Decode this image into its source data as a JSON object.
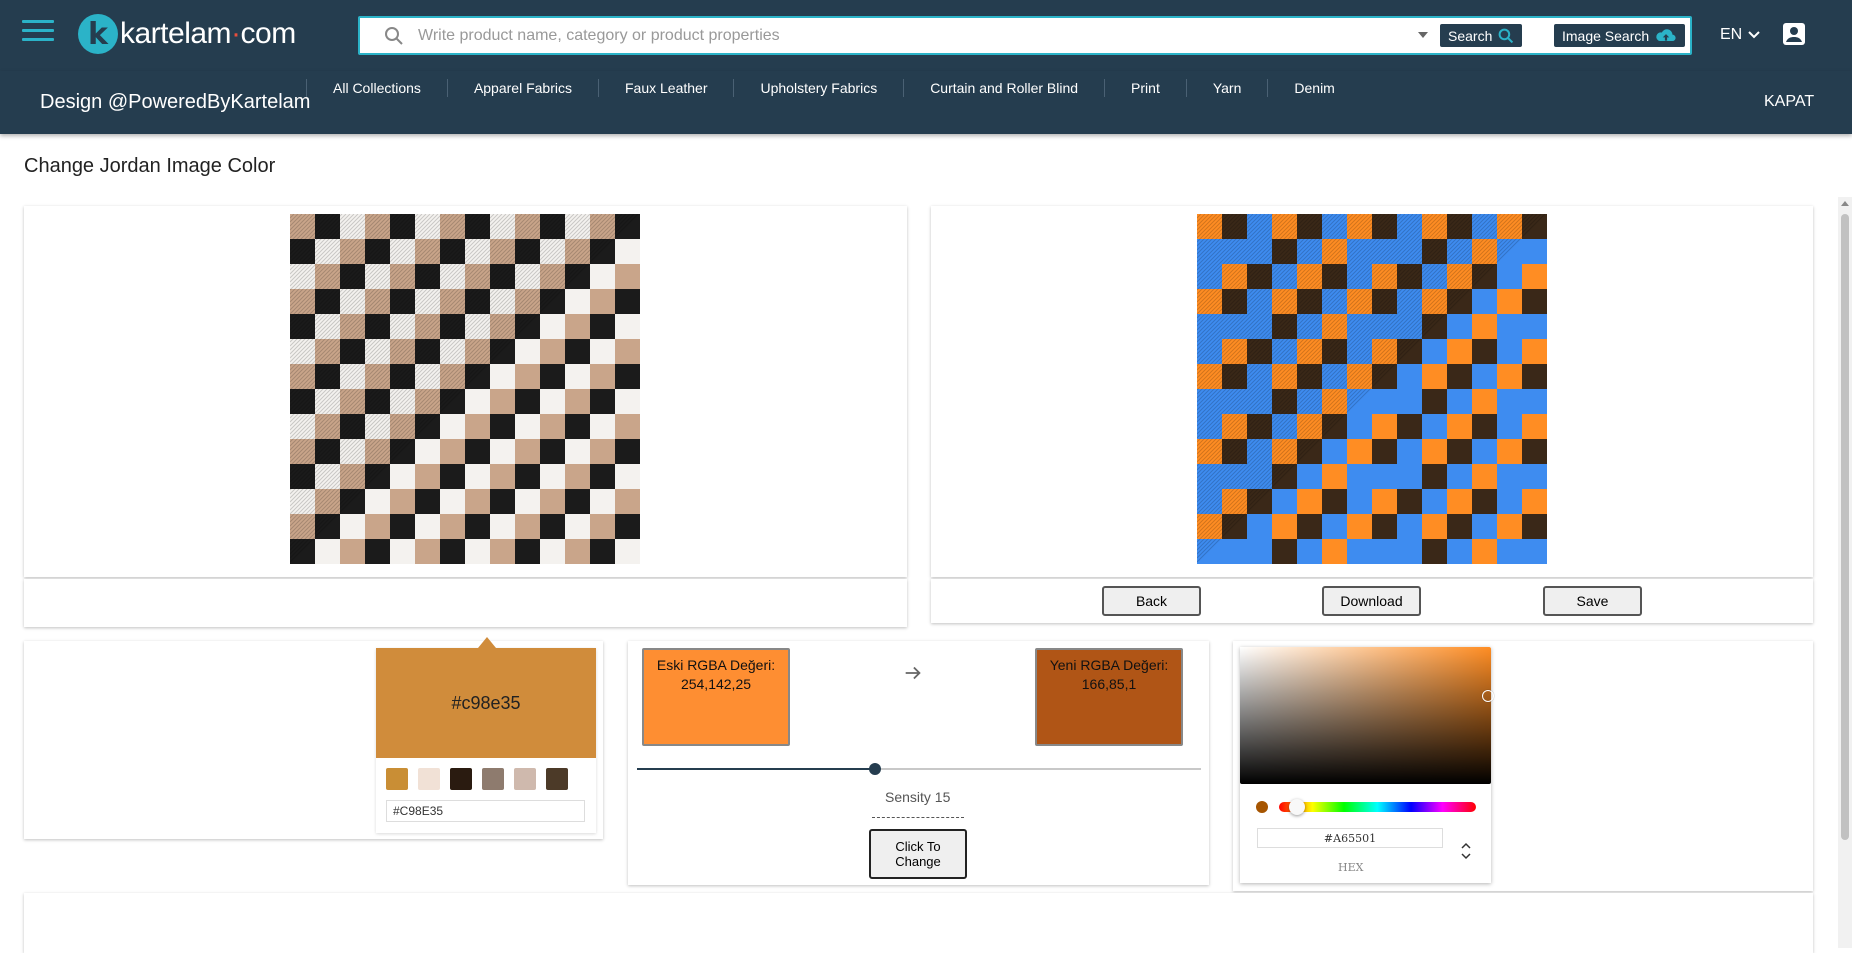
{
  "header": {
    "logo_letter": "k",
    "logo_text_a": "kartelam",
    "logo_dot": "·",
    "logo_text_b": "com",
    "search_placeholder": "Write product name, category or product properties",
    "search_label": "Search",
    "image_search_label": "Image Search",
    "language": "EN"
  },
  "subnav": {
    "title": "Design @PoweredByKartelam",
    "items": [
      "All Collections",
      "Apparel Fabrics",
      "Faux Leather",
      "Upholstery Fabrics",
      "Curtain and Roller Blind",
      "Print",
      "Yarn",
      "Denim"
    ],
    "close_label": "KAPAT"
  },
  "page": {
    "title": "Change Jordan Image Color"
  },
  "actions": {
    "back": "Back",
    "download": "Download",
    "save": "Save"
  },
  "picker_a": {
    "selected_hex": "#c98e35",
    "input_value": "#C98E35",
    "swatch_color": "#d08c3b",
    "swatches": [
      "#c98e35",
      "#f1e1d6",
      "#2a1b10",
      "#8e7b6e",
      "#cfb9ad",
      "#4c3a28"
    ]
  },
  "compare": {
    "old_label": "Eski RGBA Değeri:",
    "old_value": "254,142,25",
    "old_color": "#fe8e32",
    "new_label": "Yeni RGBA Değeri:",
    "new_value": "166,85,1",
    "new_color": "#b05516",
    "sensity_label": "Sensity 15",
    "sensity_value": 15,
    "change_button": "Click To Change"
  },
  "picker_b": {
    "hex_value": "#A65501",
    "hex_label": "HEX",
    "current_color": "#a65501"
  },
  "fabric": {
    "original_colors": [
      "#c9a58a",
      "#1b1b1b",
      "#f4f2ef"
    ],
    "modified_colors": [
      "#ff8d23",
      "#3a2818",
      "#3e8cf0"
    ]
  }
}
